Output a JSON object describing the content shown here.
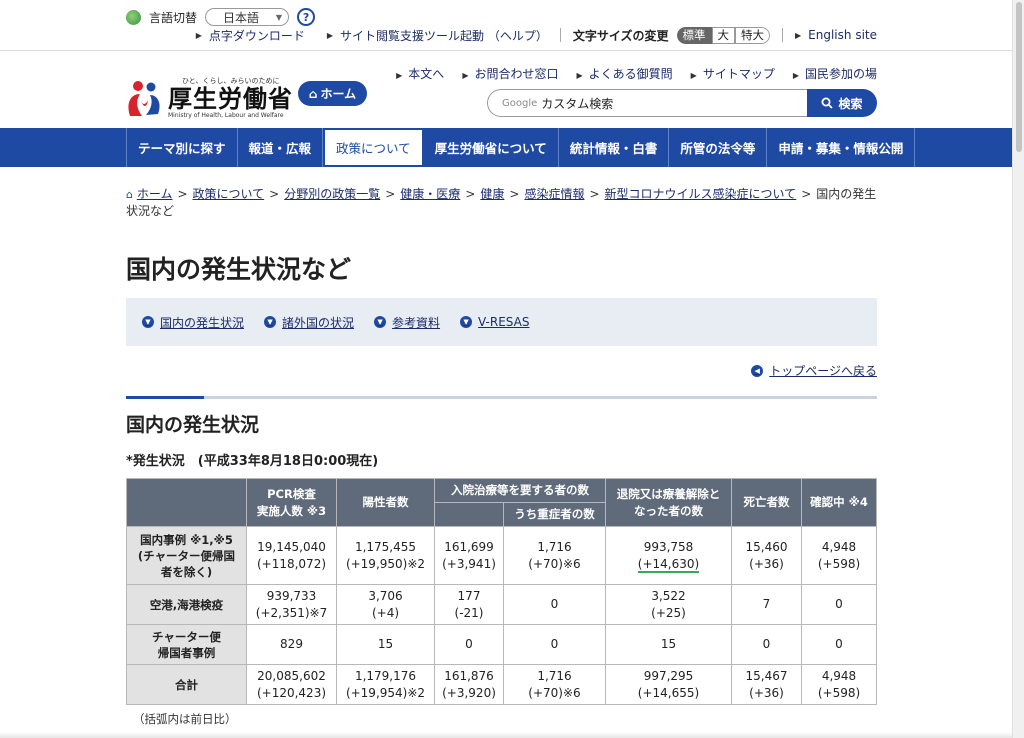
{
  "utility": {
    "lang_label": "言語切替",
    "lang_value": "日本語",
    "help": "?",
    "links": [
      "点字ダウンロード",
      "サイト閲覧支援ツール起動 （ヘルプ）"
    ],
    "font_size_label": "文字サイズの変更",
    "font_sizes": [
      "標準",
      "大",
      "特大"
    ],
    "english": "English site"
  },
  "header": {
    "logo_tagline": "ひと、くらし、みらいのために",
    "logo_name": "厚生労働省",
    "logo_en": "Ministry of Health, Labour and Welfare",
    "home_button": "ホーム",
    "subnav": [
      "本文へ",
      "お問合わせ窓口",
      "よくある御質問",
      "サイトマップ",
      "国民参加の場"
    ],
    "search_brand": "Google",
    "search_placeholder": "カスタム検索",
    "search_button": "検索"
  },
  "gnav": [
    "テーマ別に探す",
    "報道・広報",
    "政策について",
    "厚生労働省について",
    "統計情報・白書",
    "所管の法令等",
    "申請・募集・情報公開"
  ],
  "breadcrumb": [
    "ホーム",
    "政策について",
    "分野別の政策一覧",
    "健康・医療",
    "健康",
    "感染症情報",
    "新型コロナウイルス感染症について"
  ],
  "breadcrumb_current": "国内の発生状況など",
  "page_title": "国内の発生状況など",
  "anchors": [
    "国内の発生状況",
    "諸外国の状況",
    "参考資料",
    "V-RESAS"
  ],
  "back_to_top": "トップページへ戻る",
  "section_title": "国内の発生状況",
  "subheading": "*発生状況　(平成33年8月18日0:00現在)",
  "table": {
    "headers": {
      "pcr": "PCR検査\n実施人数 ※3",
      "positive": "陽性者数",
      "hospital": "入院治療等を要する者の数",
      "severe": "うち重症者の数",
      "discharged": "退院又は療養解除と\nなった者の数",
      "deaths": "死亡者数",
      "confirming": "確認中 ※4"
    },
    "rows": [
      {
        "label": "国内事例 ※1,※5\n(チャーター便帰国\n者を除く)",
        "pcr": [
          "19,145,040",
          "(+118,072)"
        ],
        "positive": [
          "1,175,455",
          "(+19,950)※2"
        ],
        "hospital": [
          "161,699",
          "(+3,941)"
        ],
        "severe": [
          "1,716",
          "(+70)※6"
        ],
        "discharged": [
          "993,758",
          "(+14,630)"
        ],
        "deaths": [
          "15,460",
          "(+36)"
        ],
        "confirming": [
          "4,948",
          "(+598)"
        ]
      },
      {
        "label": "空港,海港検疫",
        "pcr": [
          "939,733",
          "(+2,351)※7"
        ],
        "positive": [
          "3,706",
          "(+4)"
        ],
        "hospital": [
          "177",
          "(-21)"
        ],
        "severe": [
          "0",
          ""
        ],
        "discharged": [
          "3,522",
          "(+25)"
        ],
        "deaths": [
          "7",
          ""
        ],
        "confirming": [
          "0",
          ""
        ]
      },
      {
        "label": "チャーター便\n帰国者事例",
        "pcr": [
          "829",
          ""
        ],
        "positive": [
          "15",
          ""
        ],
        "hospital": [
          "0",
          ""
        ],
        "severe": [
          "0",
          ""
        ],
        "discharged": [
          "15",
          ""
        ],
        "deaths": [
          "0",
          ""
        ],
        "confirming": [
          "0",
          ""
        ]
      },
      {
        "label": "合計",
        "pcr": [
          "20,085,602",
          "(+120,423)"
        ],
        "positive": [
          "1,179,176",
          "(+19,954)※2"
        ],
        "hospital": [
          "161,876",
          "(+3,920)"
        ],
        "severe": [
          "1,716",
          "(+70)※6"
        ],
        "discharged": [
          "997,295",
          "(+14,655)"
        ],
        "deaths": [
          "15,467",
          "(+36)"
        ],
        "confirming": [
          "4,948",
          "(+598)"
        ]
      }
    ]
  },
  "footnote": "（括弧内は前日比）",
  "colors": {
    "brand_blue": "#1f4aa3",
    "header_gray": "#5f6a7a",
    "value_red": "#c0282b",
    "value_green": "#3a7a22"
  }
}
